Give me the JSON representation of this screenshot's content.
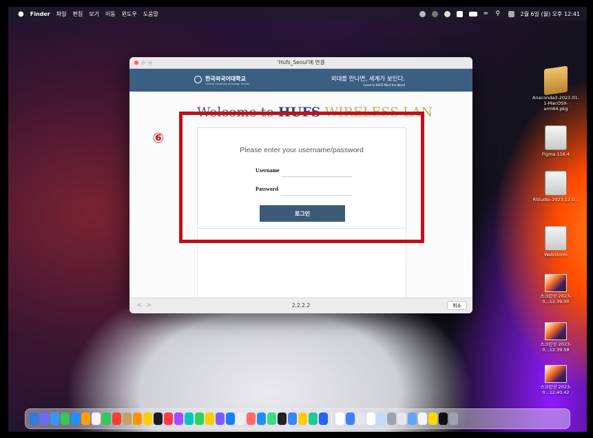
{
  "menubar": {
    "apple": "",
    "app": "Finder",
    "items": [
      "파일",
      "편집",
      "보기",
      "이동",
      "윈도우",
      "도움말"
    ],
    "clock": "2월 6일 (월) 오후 12:41"
  },
  "dialog": {
    "title": "'Hufs_Seoul'에 연결",
    "banner": {
      "univ_name": "한국외국어대학교",
      "univ_sub": "Hankuk University of Foreign Studies",
      "slogan": "외대를 만나면, 세계가 보인다.",
      "slogan_sub": "Come to HUFS Meet the World"
    },
    "welcome": {
      "part1": "Welcome to ",
      "part2": "HUFS",
      "part3": " WIRELESS LAN"
    },
    "prompt": "Please enter your username/password",
    "username_label": "Username",
    "password_label": "Password",
    "username_value": "",
    "password_value": "",
    "login_button": "로그인",
    "nav_back": "<",
    "nav_forward": ">",
    "version": "2.2.2.2",
    "cancel_button": "취소"
  },
  "annotation": {
    "step": "⑥",
    "color": "#c0101a"
  },
  "desktop_icons": [
    {
      "name": "Anaconda3-2023.01-1-MacOSX-arm64.pkg",
      "type": "pkg"
    },
    {
      "name": "Figma 116.4",
      "type": "disk"
    },
    {
      "name": "RStudio-2023.12.0...",
      "type": "disk"
    },
    {
      "name": "WebStorm",
      "type": "disk"
    },
    {
      "name": "스크린샷 2023-0...12.39.00",
      "type": "screenshot"
    },
    {
      "name": "스크린샷 2023-0...12.39.58",
      "type": "screenshot"
    },
    {
      "name": "스크린샷 2023-0...12.40.42",
      "type": "screenshot"
    }
  ],
  "dock": {
    "app_colors": [
      "#2a7de1",
      "#6b6bff",
      "#3399ff",
      "#34c759",
      "#1e90ff",
      "#ff9f0a",
      "#f5f5f5",
      "#34c759",
      "#ff3b30",
      "#c8a060",
      "#ff9500",
      "#ffcc00",
      "#1c1c1e",
      "#fc3c44",
      "#a24bff",
      "#00c7be",
      "#30d158",
      "#ffcc00",
      "#7d5cff",
      "#147efb",
      "#eeeeee",
      "#ff6b6b",
      "#1e8dff",
      "#3ddc84",
      "#222",
      "#3a86ff",
      "#ffcc00",
      "#20c997",
      "#2563eb"
    ],
    "doc_colors": [
      "#ffffff",
      "#3b82f6",
      "#e5e7eb",
      "#ffffff",
      "#bfdbfe",
      "#9ca3af",
      "#e5e7eb",
      "#60a5fa",
      "#f3f4f6",
      "#ffd60a",
      "#111111",
      "#9ca3af"
    ]
  }
}
